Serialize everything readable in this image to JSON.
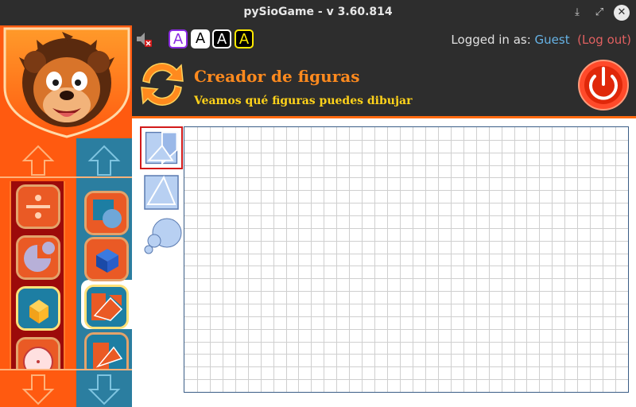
{
  "window": {
    "title": "pySioGame - v 3.60.814",
    "controls": {
      "minimize": "⤓",
      "maximize": "⤢",
      "close": "✕"
    }
  },
  "toolbar": {
    "font_buttons": [
      "A",
      "A",
      "A",
      "A"
    ],
    "sound_icon": "speaker-muted-icon",
    "login_label": "Logged in as:",
    "user": "Guest",
    "logout": "(Log out)"
  },
  "header": {
    "title": "Creador de figuras",
    "subtitle": "Veamos qué figuras puedes dibujar"
  },
  "sidebar": {
    "left_items": [
      "division-icon",
      "fraction-pie-icon",
      "3d-cube-icon",
      "clock-icon"
    ],
    "right_items": [
      "shapes-icon",
      "blue-cube-icon",
      "shape-maker-icon",
      "shape-maker-alt-icon"
    ],
    "selected_right_index": 2
  },
  "tools": [
    "polygon-tool-icon",
    "triangle-tool-icon",
    "circle-tool-icon"
  ],
  "canvas": {
    "grid_columns": 35,
    "grid_rows": 21
  },
  "colors": {
    "orange": "#ff5a10",
    "teal": "#2b7ea0",
    "dark": "#2d2d2d",
    "grid_line": "#cfcfcf",
    "grid_border": "#3a5d86",
    "title_orange": "#ff8a1e",
    "subtitle_yellow": "#ffd21a"
  }
}
